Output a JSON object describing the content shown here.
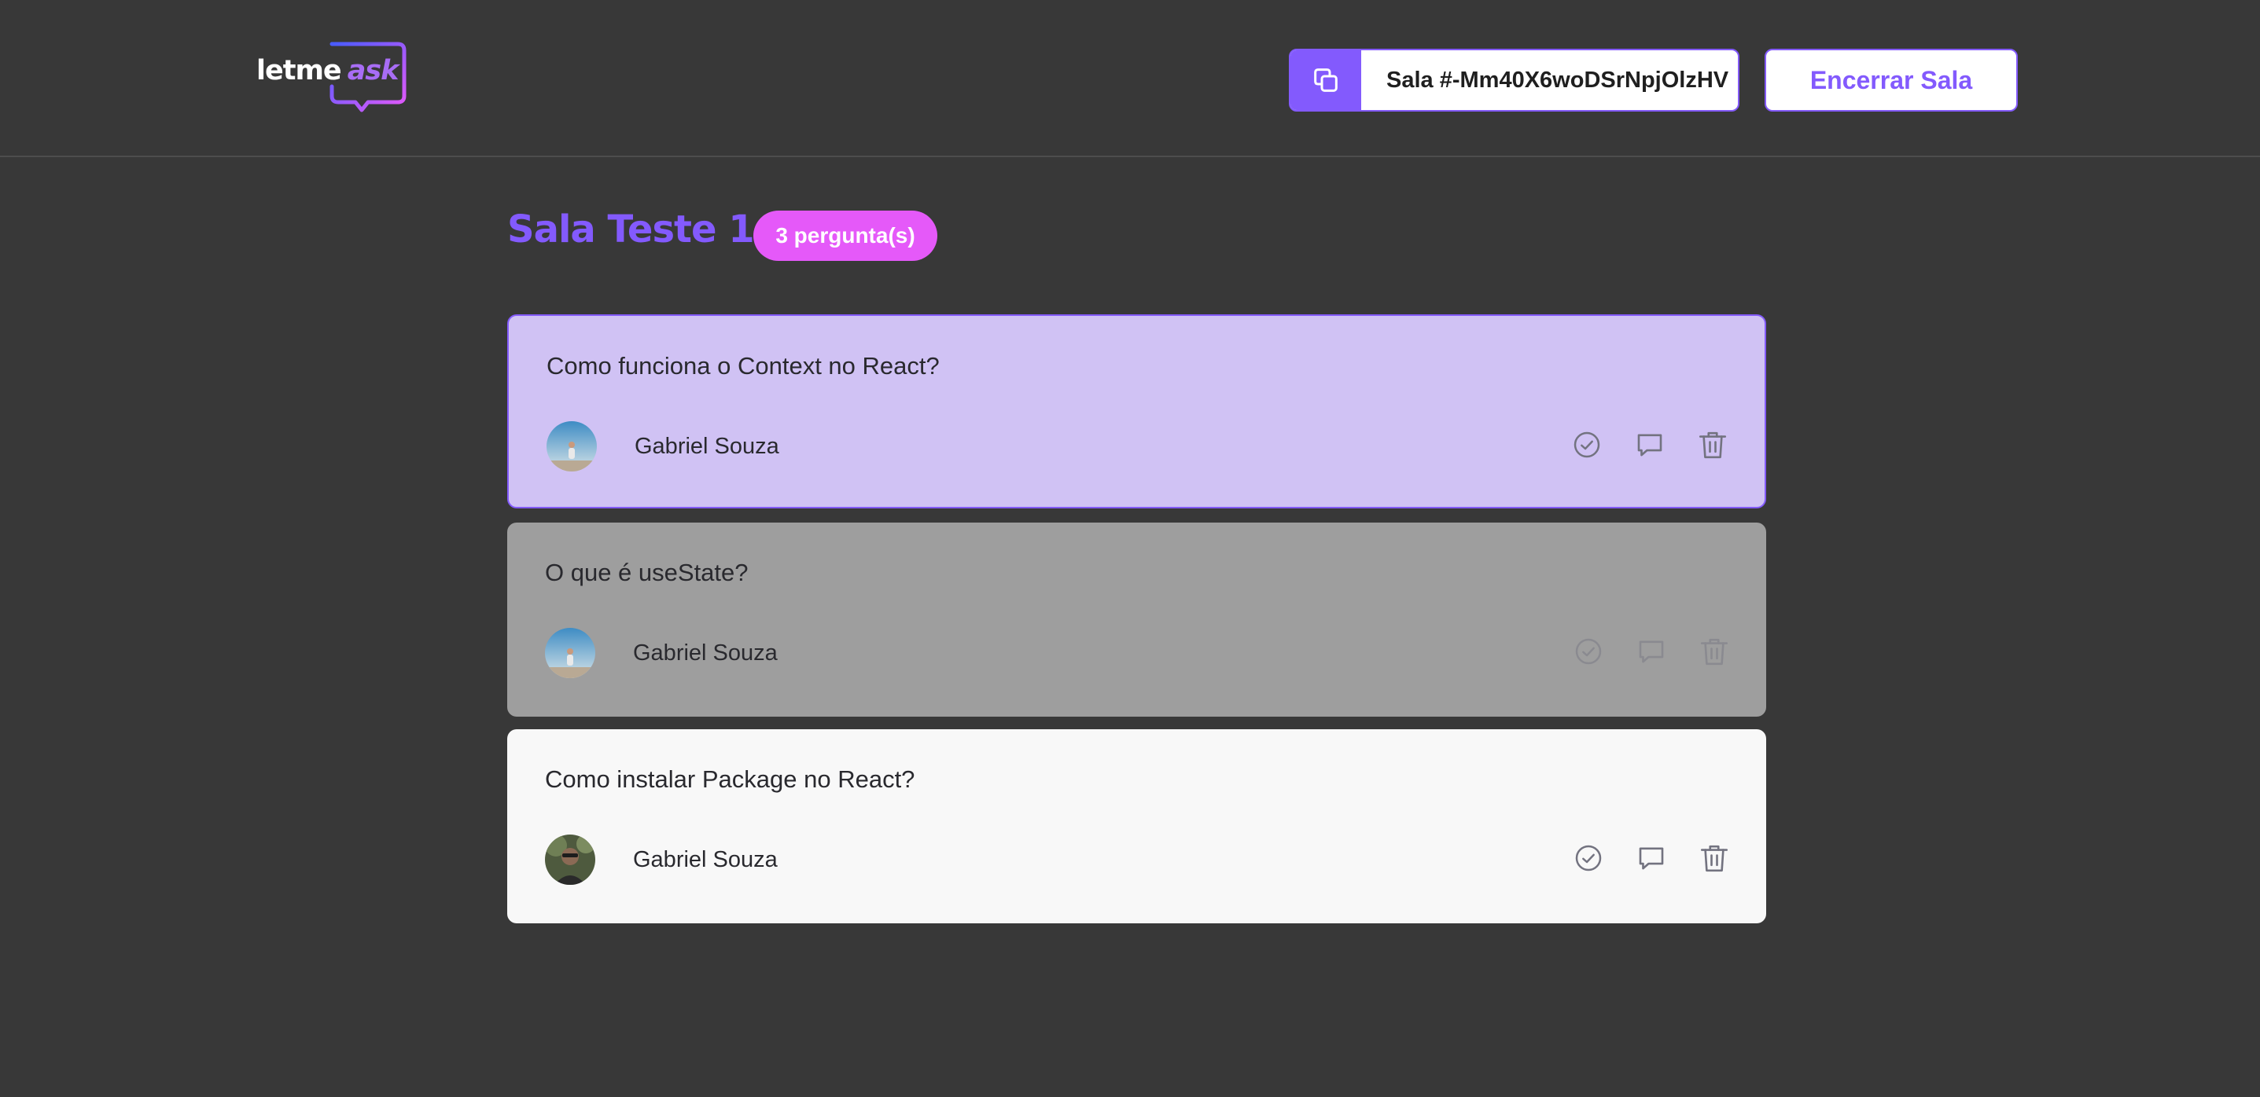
{
  "header": {
    "logo": {
      "part1": "letme",
      "part2": "ask"
    },
    "room_code_label": "Sala #-Mm40X6woDSrNpjOlzHV",
    "close_room_label": "Encerrar Sala"
  },
  "room": {
    "title": "Sala Teste 1",
    "question_count_label": "3 pergunta(s)"
  },
  "questions": [
    {
      "text": "Como funciona o Context no React?",
      "author": "Gabriel Souza",
      "state": "highlighted"
    },
    {
      "text": "O que é useState?",
      "author": "Gabriel Souza",
      "state": "answered"
    },
    {
      "text": "Como instalar Package no React?",
      "author": "Gabriel Souza",
      "state": "normal"
    }
  ],
  "icons": {
    "copy": "copy-icon",
    "check": "check-circle-icon",
    "answer": "chat-bubble-icon",
    "delete": "trash-icon"
  },
  "colors": {
    "background": "#383838",
    "brand": "#835afd",
    "badge": "#e559f9",
    "highlighted_card": "#d0c2f4",
    "answered_card": "#9e9e9e",
    "card": "#f8f8f8"
  }
}
